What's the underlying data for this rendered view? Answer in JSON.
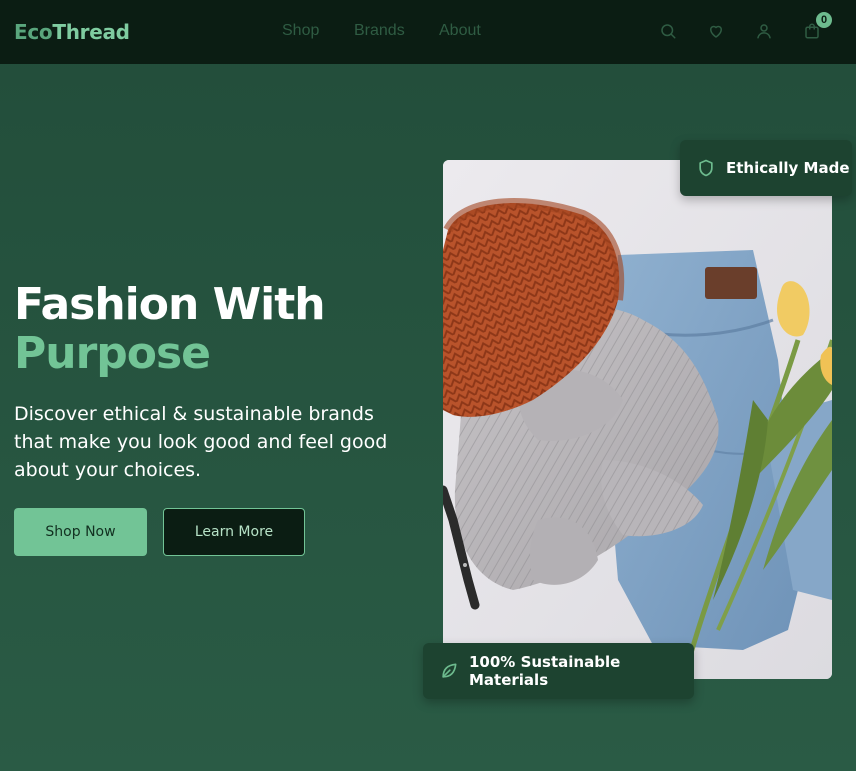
{
  "brand": {
    "part1": "Eco",
    "part2": "Thread"
  },
  "nav": {
    "links": [
      {
        "label": "Shop"
      },
      {
        "label": "Brands"
      },
      {
        "label": "About"
      }
    ],
    "icons": [
      "search-icon",
      "heart-icon",
      "user-icon",
      "shopping-bag-icon"
    ],
    "cart_count": "0"
  },
  "hero": {
    "title_line1": "Fashion With",
    "title_line2": "Purpose",
    "description": "Discover ethical & sustainable brands that make you look good and feel good about your choices.",
    "primary_button": "Shop Now",
    "secondary_button": "Learn More"
  },
  "badges": {
    "ethical": {
      "label": "Ethically Made",
      "icon": "shield-icon"
    },
    "sustainable": {
      "label": "100% Sustainable Materials",
      "icon": "leaf-icon"
    }
  },
  "colors": {
    "nav_bg": "#0b1d13",
    "hero_bg": "#224d3a",
    "accent": "#72c496",
    "badge_bg": "#1d4330"
  }
}
